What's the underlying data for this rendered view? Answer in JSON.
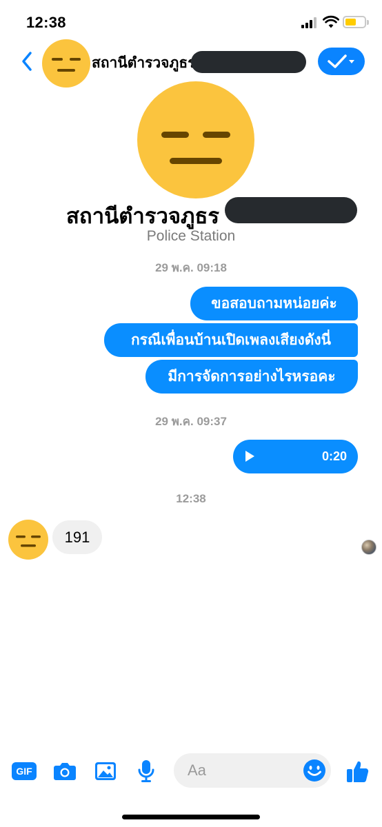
{
  "status_bar": {
    "time": "12:38",
    "battery_color": "#ffcc00"
  },
  "header": {
    "contact_name": "สถานีตำรวจภูธร",
    "back_icon": "chevron-left-icon",
    "action_icon": "checkmark-dropdown-icon"
  },
  "profile": {
    "name": "สถานีตำรวจภูธร",
    "subtitle": "Police Station",
    "avatar_icon": "expressionless-face-icon"
  },
  "conversation": {
    "timestamp_1": "29 พ.ค. 09:18",
    "outgoing_messages": [
      "ขอสอบถามหน่อยค่ะ",
      "กรณีเพื่อนบ้านเปิดเพลงเสียงดังนี่",
      "มีการจัดการอย่างไรหรอคะ"
    ],
    "timestamp_2": "29 พ.ค. 09:37",
    "voice_message": {
      "duration": "0:20",
      "icon": "play-icon"
    },
    "timestamp_3": "12:38",
    "incoming_message": "191"
  },
  "composer": {
    "gif_label": "GIF",
    "placeholder": "Aa",
    "icons": [
      "gif-icon",
      "camera-icon",
      "photo-icon",
      "microphone-icon",
      "emoji-icon",
      "thumbs-up-icon"
    ]
  },
  "colors": {
    "accent": "#0a84ff",
    "outgoing_bubble": "#0a8eff",
    "incoming_bubble": "#f0f0f0",
    "avatar_yellow": "#fbc43e",
    "redaction": "#262a2e",
    "timestamp_gray": "#9b9b9b"
  }
}
